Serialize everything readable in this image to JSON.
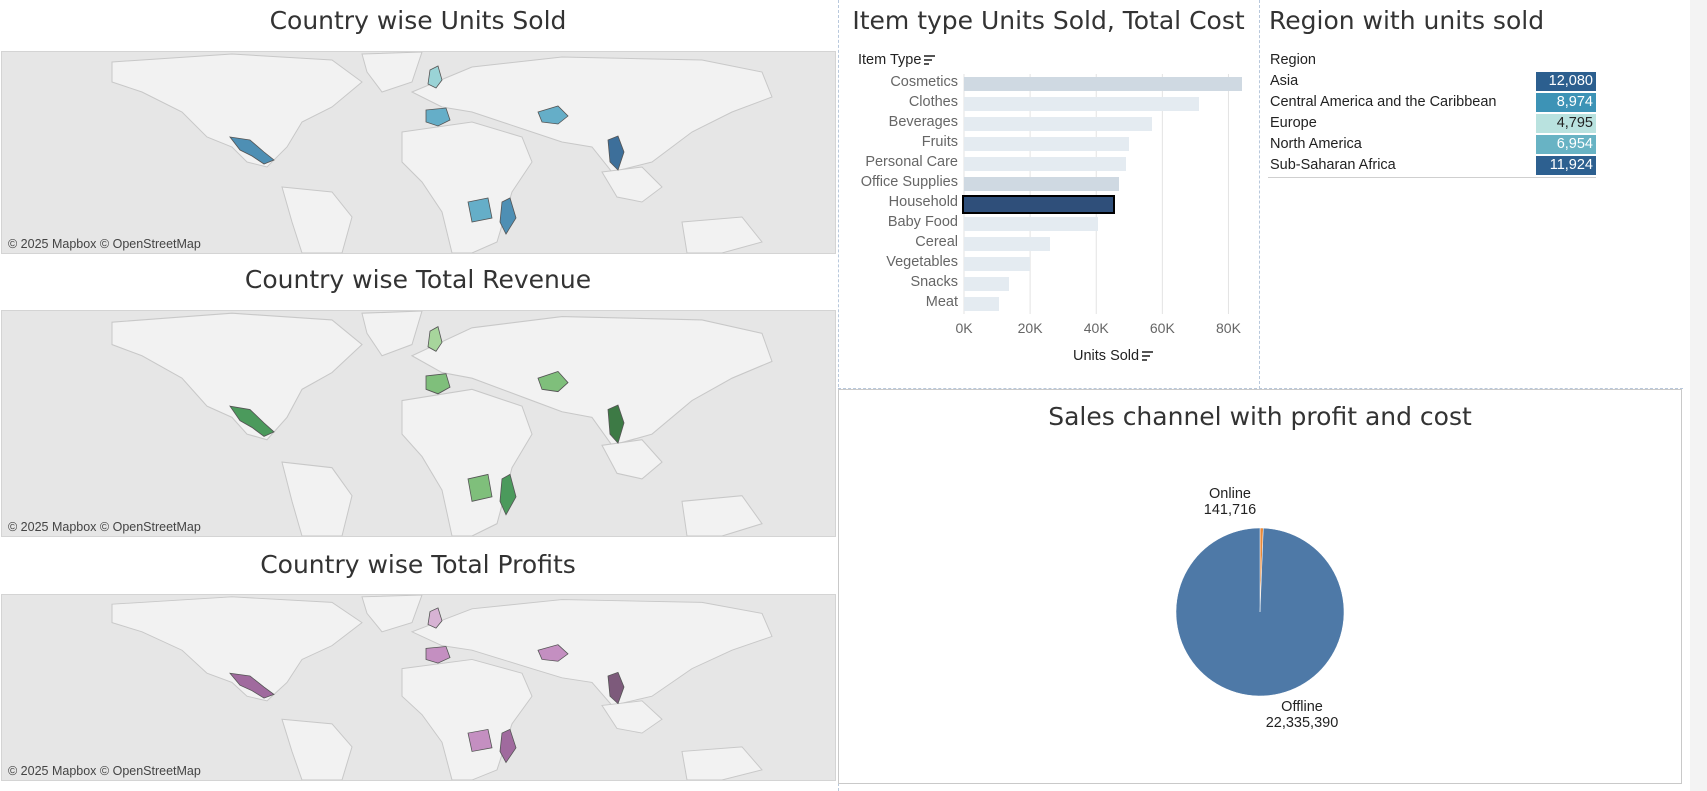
{
  "maps": [
    {
      "title": "Country wise Units Sold",
      "credit": "© 2025 Mapbox © OpenStreetMap",
      "palette": [
        "#4e8fb4",
        "#65aec8",
        "#9ad3d6",
        "#3d6f9a"
      ]
    },
    {
      "title": "Country wise Total Revenue",
      "credit": "© 2025 Mapbox © OpenStreetMap",
      "palette": [
        "#4b9a5c",
        "#7fbf7b",
        "#a7d59c",
        "#3d7a45"
      ]
    },
    {
      "title": "Country wise Total Profits",
      "credit": "© 2025 Mapbox © OpenStreetMap",
      "palette": [
        "#a06a9e",
        "#c48fc1",
        "#d7b3d4",
        "#7d5a7b"
      ]
    }
  ],
  "item_chart": {
    "title": "Item type Units Sold, Total Cost",
    "column_header": "Item Type",
    "xlabel": "Units Sold",
    "colors": {
      "light": "#e4ebf1",
      "medium": "#cfd9e2",
      "highlight": "#2f4f7a",
      "highlight_border": "#000000"
    }
  },
  "region_table": {
    "title": "Region with units sold",
    "header": "Region",
    "rows": [
      {
        "name": "Asia",
        "value": "12,080",
        "color": "#2c5f8f"
      },
      {
        "name": "Central America and the Caribbean",
        "value": "8,974",
        "color": "#3d93b6"
      },
      {
        "name": "Europe",
        "value": "4,795",
        "color": "#b9e2df"
      },
      {
        "name": "North America",
        "value": "6,954",
        "color": "#68b3c4"
      },
      {
        "name": "Sub-Saharan Africa",
        "value": "11,924",
        "color": "#2d6090"
      }
    ]
  },
  "pie": {
    "title": "Sales channel with profit and cost"
  },
  "chart_data": [
    {
      "type": "bar",
      "title": "Item type Units Sold, Total Cost",
      "ylabel": "Item Type",
      "xlabel": "Units Sold",
      "orientation": "horizontal",
      "categories": [
        "Cosmetics",
        "Clothes",
        "Beverages",
        "Fruits",
        "Personal Care",
        "Office Supplies",
        "Household",
        "Baby Food",
        "Cereal",
        "Vegetables",
        "Snacks",
        "Meat"
      ],
      "values": [
        84000,
        71000,
        57000,
        50000,
        49000,
        47000,
        45000,
        40500,
        26000,
        20000,
        13500,
        10500
      ],
      "shade": [
        "medium",
        "light",
        "light",
        "light",
        "light",
        "medium",
        "highlight",
        "light",
        "light",
        "light",
        "light",
        "light"
      ],
      "xlim": [
        0,
        85000
      ],
      "xticks": [
        0,
        20000,
        40000,
        60000,
        80000
      ],
      "xtick_labels": [
        "0K",
        "20K",
        "40K",
        "60K",
        "80K"
      ],
      "grid": true
    },
    {
      "type": "pie",
      "title": "Sales channel with profit and cost",
      "labels": [
        "Online",
        "Offline"
      ],
      "values": [
        141716,
        22335390
      ],
      "value_labels": [
        "141,716",
        "22,335,390"
      ],
      "colors": [
        "#e8893a",
        "#4e79a7"
      ]
    }
  ]
}
